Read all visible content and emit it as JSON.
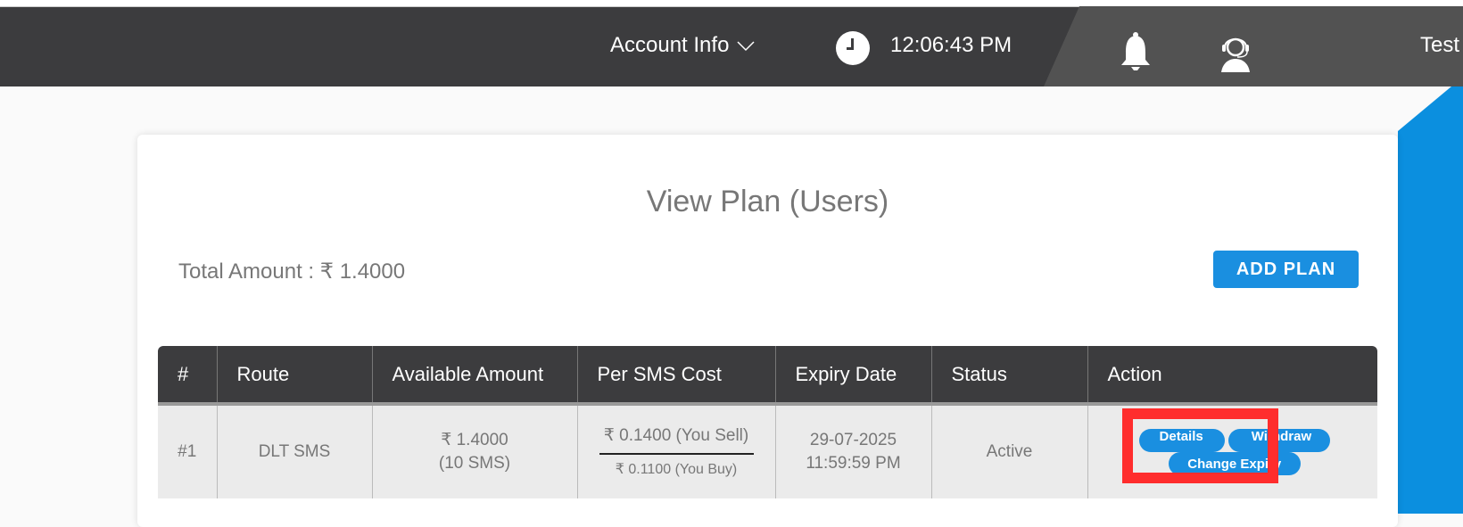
{
  "topbar": {
    "account_menu_label": "Account Info",
    "time": "12:06:43 PM",
    "icons": {
      "chevron": "chevron-down-icon",
      "clock": "clock-icon",
      "notifications": "bell-icon",
      "support": "headset-support-icon"
    },
    "username": "Test"
  },
  "page": {
    "title": "View Plan (Users)",
    "total_amount_label": "Total Amount : ₹ 1.4000",
    "add_plan_label": "ADD PLAN"
  },
  "table": {
    "headers": [
      "#",
      "Route",
      "Available Amount",
      "Per SMS Cost",
      "Expiry Date",
      "Status",
      "Action"
    ],
    "rows": [
      {
        "index": "#1",
        "route": "DLT SMS",
        "available_amount": "₹ 1.4000",
        "available_sms": "(10 SMS)",
        "cost_sell": "₹ 0.1400 (You Sell)",
        "cost_buy": "₹ 0.1100 (You Buy)",
        "expiry_date": "29-07-2025",
        "expiry_time": "11:59:59 PM",
        "status": "Active",
        "actions": {
          "details": "Details",
          "withdraw": "Withdraw",
          "change_expiry": "Change Expiry"
        }
      }
    ]
  },
  "colors": {
    "topbar": "#3c3c3e",
    "accent_blue": "#1a8fe0",
    "status_active": "#2e9a3e",
    "highlight": "#ff2d2d"
  }
}
